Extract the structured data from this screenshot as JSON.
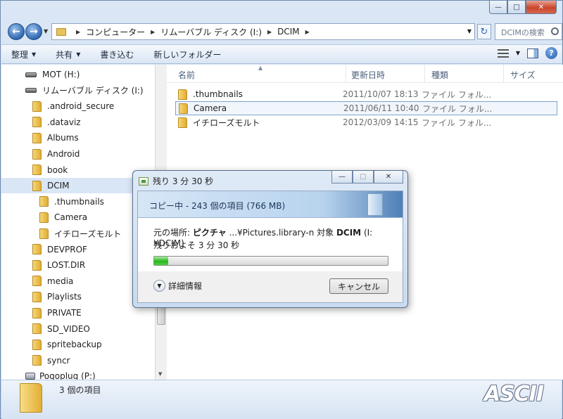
{
  "window": {
    "controls": {
      "minimize": "—",
      "maximize": "□",
      "close": "✕"
    }
  },
  "address_bar": {
    "crumbs": [
      "コンピューター",
      "リムーバブル ディスク (I:)",
      "DCIM"
    ]
  },
  "search": {
    "placeholder": "DCIMの検索"
  },
  "toolbar": {
    "organize": "整理",
    "share": "共有",
    "burn": "書き込む",
    "new_folder": "新しいフォルダー"
  },
  "nav_tree": {
    "items": [
      {
        "label": "MOT (H:)",
        "kind": "drive",
        "indent": 0
      },
      {
        "label": "リムーバブル ディスク (I:)",
        "kind": "drive",
        "indent": 0
      },
      {
        "label": ".android_secure",
        "kind": "folder",
        "indent": 1
      },
      {
        "label": ".dataviz",
        "kind": "folder",
        "indent": 1
      },
      {
        "label": "Albums",
        "kind": "folder",
        "indent": 1
      },
      {
        "label": "Android",
        "kind": "folder",
        "indent": 1
      },
      {
        "label": "book",
        "kind": "folder",
        "indent": 1
      },
      {
        "label": "DCIM",
        "kind": "folder",
        "indent": 1,
        "selected": true
      },
      {
        "label": ".thumbnails",
        "kind": "folder",
        "indent": 2
      },
      {
        "label": "Camera",
        "kind": "folder",
        "indent": 2
      },
      {
        "label": "イチローズモルト",
        "kind": "folder",
        "indent": 2
      },
      {
        "label": "DEVPROF",
        "kind": "folder",
        "indent": 1
      },
      {
        "label": "LOST.DIR",
        "kind": "folder",
        "indent": 1
      },
      {
        "label": "media",
        "kind": "folder",
        "indent": 1
      },
      {
        "label": "Playlists",
        "kind": "folder",
        "indent": 1
      },
      {
        "label": "PRIVATE",
        "kind": "folder",
        "indent": 1
      },
      {
        "label": "SD_VIDEO",
        "kind": "folder",
        "indent": 1
      },
      {
        "label": "spritebackup",
        "kind": "folder",
        "indent": 1
      },
      {
        "label": "syncr",
        "kind": "folder",
        "indent": 1
      },
      {
        "label": "Pogoplug (P:)",
        "kind": "pc-drive",
        "indent": 1
      }
    ]
  },
  "columns": {
    "name": "名前",
    "date": "更新日時",
    "type": "種類",
    "size": "サイズ"
  },
  "files": [
    {
      "name": ".thumbnails",
      "date": "2011/10/07 18:13",
      "type": "ファイル フォル..."
    },
    {
      "name": "Camera",
      "date": "2011/06/11 10:40",
      "type": "ファイル フォル...",
      "selected": true
    },
    {
      "name": "イチローズモルト",
      "date": "2012/03/09 14:15",
      "type": "ファイル フォル..."
    }
  ],
  "status": {
    "count": "3 個の項目",
    "watermark": "ASCII"
  },
  "copy_dialog": {
    "title": "残り 3 分 30 秒",
    "header": "コピー中 - 243 個の項目 (766 MB)",
    "from_prefix": "元の場所: ",
    "from_name": "ピクチャ",
    "from_path": " ...¥Pictures.library-n 対象 ",
    "to_name": "DCIM",
    "to_path": " (I:¥DCIM)",
    "remaining": "残りおよそ 3 分 30 秒",
    "progress": 0.06,
    "more_details": "詳細情報",
    "cancel": "キャンセル"
  }
}
